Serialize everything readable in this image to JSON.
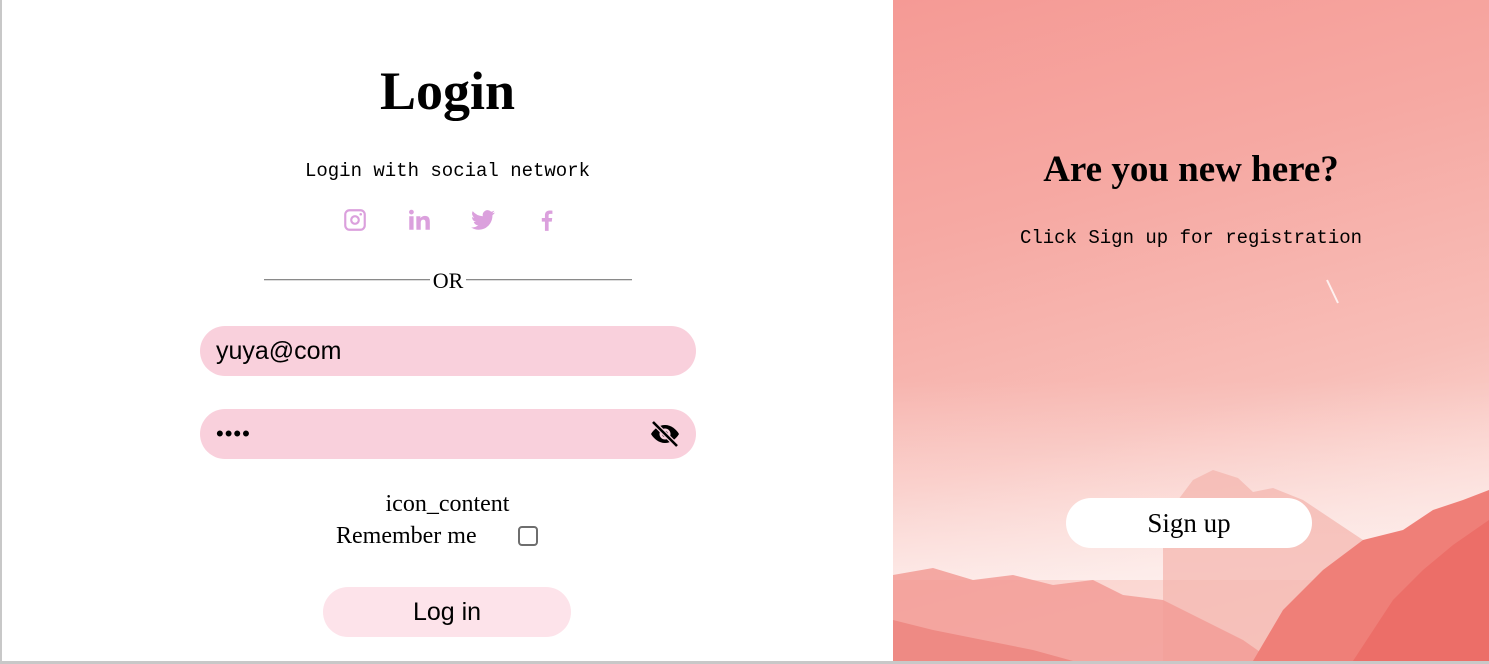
{
  "login": {
    "title": "Login",
    "social_text": "Login with social network",
    "socials": [
      {
        "icon": "instagram-icon"
      },
      {
        "icon": "linkedin-icon"
      },
      {
        "icon": "twitter-icon"
      },
      {
        "icon": "facebook-icon"
      }
    ],
    "social_color": "#dba0dd",
    "divider_text": "OR",
    "email_value": "yuya@com",
    "password_value": "••••",
    "password_toggle_icon": "eye-slash-icon",
    "icon_placeholder_text": "icon_content",
    "remember_label": "Remember me",
    "remember_checked": false,
    "login_button": "Log in",
    "field_color": "#f9d0dc",
    "button_color": "#fde3ea"
  },
  "signup_panel": {
    "title": "Are you new here?",
    "subtitle": "Click Sign up for registration",
    "signup_button": "Sign up",
    "accent": "#f59a95"
  }
}
